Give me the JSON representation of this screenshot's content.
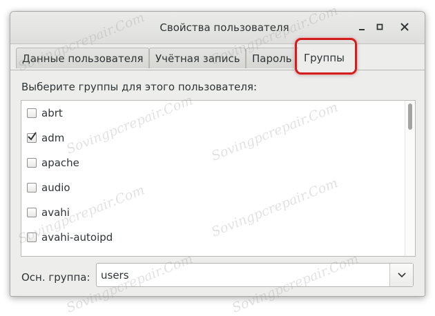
{
  "window": {
    "title": "Свойства пользователя"
  },
  "tabs": [
    {
      "label": "Данные пользователя"
    },
    {
      "label": "Учётная запись"
    },
    {
      "label": "Пароль"
    },
    {
      "label": "Группы",
      "active": true
    }
  ],
  "groups_tab": {
    "prompt": "Выберите группы для этого пользователя:",
    "groups": [
      {
        "name": "abrt",
        "checked": false
      },
      {
        "name": "adm",
        "checked": true
      },
      {
        "name": "apache",
        "checked": false
      },
      {
        "name": "audio",
        "checked": false
      },
      {
        "name": "avahi",
        "checked": false
      },
      {
        "name": "avahi-autoipd",
        "checked": false
      }
    ],
    "primary_group_label": "Осн. группа:",
    "primary_group_value": "users"
  },
  "watermark": "Sovingpcrepair.Com",
  "colors": {
    "highlight": "#d01e1e",
    "window_bg": "#ededec"
  }
}
